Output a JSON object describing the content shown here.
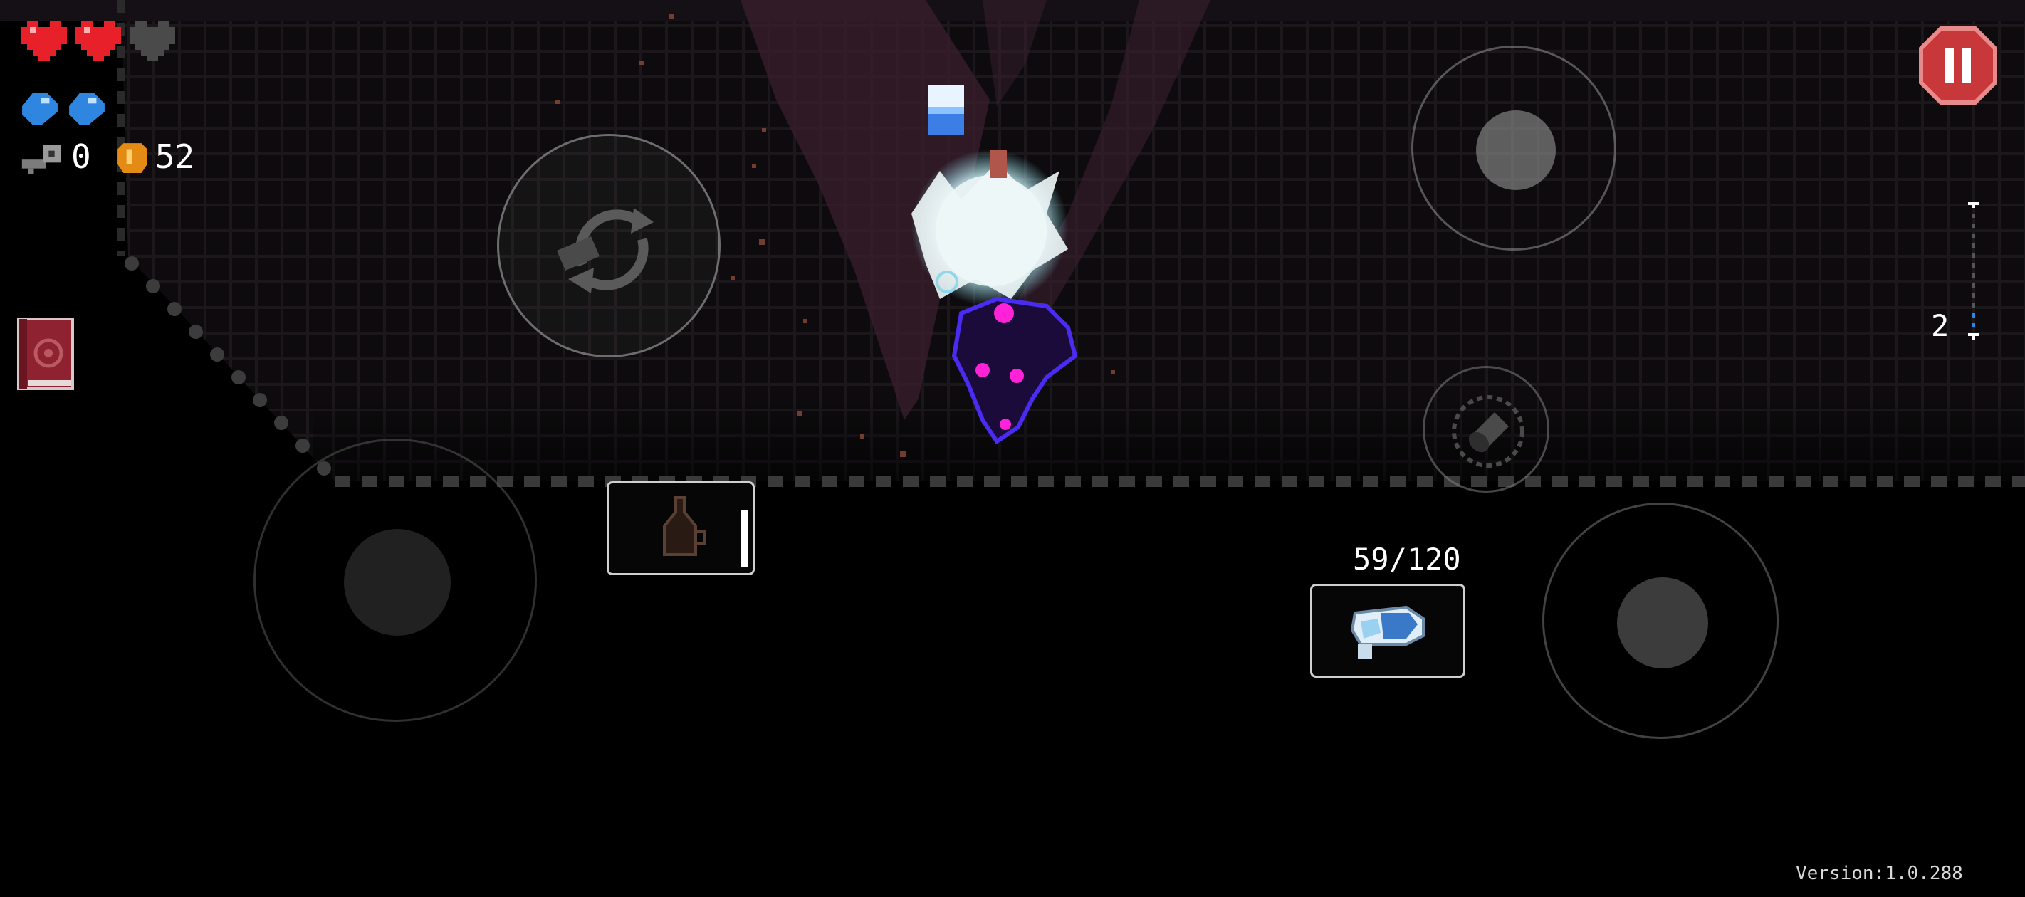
{
  "hud": {
    "health": {
      "full_hearts": 2,
      "total_hearts": 3,
      "full_color": "#e8202a",
      "empty_color": "#4a4a4a"
    },
    "shields": {
      "count": 2,
      "color": "#2e86e0"
    },
    "keys": {
      "icon": "key-icon",
      "count": "0"
    },
    "coins": {
      "icon": "coin-icon",
      "count": "52"
    }
  },
  "book_button": {
    "icon": "book-icon",
    "color": "#8e2230"
  },
  "pause_button": {
    "icon": "pause-icon",
    "color": "#c8373a"
  },
  "controls": {
    "move_joystick": {
      "icon": "joystick-knob"
    },
    "swap_button": {
      "icon": "swap-weapon-icon"
    },
    "aim_joystick": {
      "icon": "joystick-knob"
    },
    "skill_button": {
      "icon": "skill-icon"
    },
    "fire_joystick": {
      "icon": "joystick-knob"
    }
  },
  "item_slot": {
    "icon": "potion-icon",
    "charge": 1.0
  },
  "weapon": {
    "ammo": "59/120",
    "icon": "crystal-gun-icon"
  },
  "floor": {
    "number": "2"
  },
  "version": "Version:1.0.288"
}
